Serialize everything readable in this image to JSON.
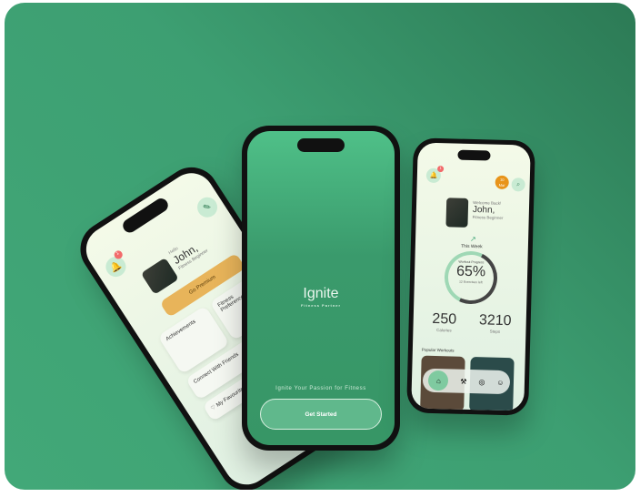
{
  "left_phone": {
    "greeting": "Hello",
    "name": "John,",
    "level": "Fitness Beginner",
    "premium": "Go Premium",
    "cards": [
      "Fitness Preferences",
      "Achievements",
      "Connect With Friends",
      "My Favourites"
    ],
    "badge": "1"
  },
  "center_phone": {
    "logo": "Ignite",
    "logo_sub": "Fitness Partner",
    "tagline": "Ignite Your Passion for Fitness",
    "cta": "Get Started"
  },
  "right_phone": {
    "badge": "1",
    "date_day": "10",
    "date_month": "Mar",
    "welcome": "Welcome Back!",
    "name": "John,",
    "level": "Fitness Beginner",
    "week": "This Week",
    "progress_label": "Workout Progress",
    "progress": "65%",
    "progress_value": 0.65,
    "exercises_left": "12 Exercises left",
    "calories": "250",
    "calories_label": "Calories",
    "steps": "3210",
    "steps_label": "Steps",
    "popular": "Popular Workouts"
  },
  "colors": {
    "accent": "#3fa476",
    "orange": "#e8941a"
  }
}
